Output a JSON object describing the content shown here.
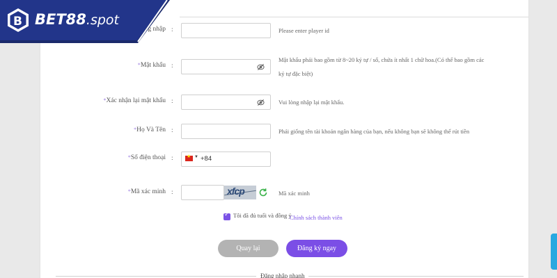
{
  "brand": {
    "name": "BET88",
    "domain": ".spot",
    "logo_letter": "B"
  },
  "form": {
    "username": {
      "label": "đăng nhập",
      "hint": "Please enter player id",
      "value": ""
    },
    "password": {
      "label": "Mật khẩu",
      "hint_line1": "Mật khẩu phải bao gồm từ 8~20 ký tự / số, chứa ít nhất 1 chữ hoa.(Có thể bao gồm các",
      "hint_line2": "ký tự đặc biệt)",
      "value": ""
    },
    "confirm_password": {
      "label": "Xác nhận lại mật khẩu",
      "hint": "Vui lòng nhập lại mật khẩu.",
      "value": ""
    },
    "fullname": {
      "label": "Họ Và Tên",
      "hint": "Phải giống tên tài khoản ngân hàng của bạn, nếu không bạn sẽ không thể rút tiền",
      "value": ""
    },
    "phone": {
      "label": "Số điện thoại",
      "country_code": "+84",
      "value": ""
    },
    "captcha": {
      "label": "Mã xác minh",
      "hint": "Mã xác minh",
      "image_text": "xfcp",
      "value": ""
    },
    "required_mark": "*",
    "colon": ":",
    "agree": {
      "text": "Tôi đã đủ tuổi và đồng ý",
      "link": "Chính sách thành viên",
      "checked": true
    },
    "back_button": "Quay lại",
    "register_button": "Đăng ký ngay",
    "quick_login": "Đăng nhập nhanh"
  },
  "colors": {
    "accent": "#7b4ee6",
    "logo_bg": "#1b2a6b",
    "button_gray": "#b3b3b3"
  }
}
